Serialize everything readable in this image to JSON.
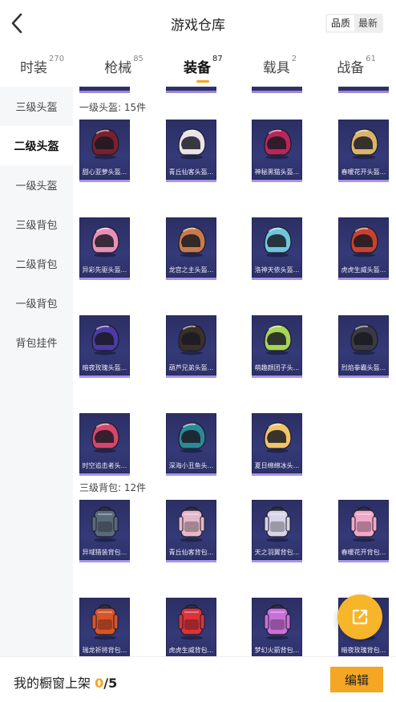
{
  "header": {
    "title": "游戏仓库",
    "sort_options": [
      "品质",
      "最新"
    ],
    "sort_active": "品质"
  },
  "category_tabs": [
    {
      "label": "时装",
      "count": "270",
      "active": false
    },
    {
      "label": "枪械",
      "count": "85",
      "active": false
    },
    {
      "label": "装备",
      "count": "87",
      "active": true
    },
    {
      "label": "载具",
      "count": "2",
      "active": false
    },
    {
      "label": "战备",
      "count": "61",
      "active": false
    }
  ],
  "sidebar": {
    "items": [
      {
        "label": "三级头盔",
        "active": false
      },
      {
        "label": "二级头盔",
        "active": true
      },
      {
        "label": "一级头盔",
        "active": false
      },
      {
        "label": "三级背包",
        "active": false
      },
      {
        "label": "二级背包",
        "active": false
      },
      {
        "label": "一级背包",
        "active": false
      },
      {
        "label": "背包挂件",
        "active": false
      }
    ]
  },
  "sections": [
    {
      "title": "一级头盔: 15件",
      "items": [
        {
          "name": "甜心亚萝头盔...",
          "color": "#7a1f2e",
          "type": "helmet"
        },
        {
          "name": "青丘仙客头盔...",
          "color": "#e8e4ea",
          "type": "helmet"
        },
        {
          "name": "神秘黑猫头盔...",
          "color": "#b8265a",
          "type": "helmet"
        },
        {
          "name": "春暖花开头盔...",
          "color": "#d9b46a",
          "type": "helmet"
        },
        {
          "name": "异彩先驱头盔...",
          "color": "#e88fb8",
          "type": "helmet"
        },
        {
          "name": "龙宫之主头盔...",
          "color": "#c97a4a",
          "type": "helmet"
        },
        {
          "name": "洛神天依头盔...",
          "color": "#6fc5dc",
          "type": "helmet"
        },
        {
          "name": "虎虎生威头盔...",
          "color": "#c8432e",
          "type": "helmet"
        },
        {
          "name": "暗夜玫瑰头盔...",
          "color": "#4b3aa8",
          "type": "helmet"
        },
        {
          "name": "葫芦兄弟头盔...",
          "color": "#3a3028",
          "type": "helmet"
        },
        {
          "name": "萌趣颜团子头...",
          "color": "#a8d45a",
          "type": "helmet"
        },
        {
          "name": "烈焰拳霸头盔...",
          "color": "#3a3a44",
          "type": "helmet"
        },
        {
          "name": "时空追击者头...",
          "color": "#d8456a",
          "type": "helmet"
        },
        {
          "name": "深海小丑鱼头...",
          "color": "#2a8a96",
          "type": "helmet"
        },
        {
          "name": "夏日绵绵冰头...",
          "color": "#f2c46a",
          "type": "helmet"
        }
      ]
    },
    {
      "title": "三级背包: 12件",
      "items": [
        {
          "name": "异域猎装背包...",
          "color": "#5a6a7a",
          "type": "backpack"
        },
        {
          "name": "青丘仙客背包...",
          "color": "#e4b8c8",
          "type": "backpack"
        },
        {
          "name": "天之羽翼背包...",
          "color": "#d8d4e8",
          "type": "backpack"
        },
        {
          "name": "春暖花开背包...",
          "color": "#f0a8c8",
          "type": "backpack"
        },
        {
          "name": "瑞龙祈将背包...",
          "color": "#d8542a",
          "type": "backpack"
        },
        {
          "name": "虎虎生威背包...",
          "color": "#d8343a",
          "type": "backpack"
        },
        {
          "name": "梦幻火箭背包...",
          "color": "#c870d8",
          "type": "backpack"
        },
        {
          "name": "暗夜玫瑰背包...",
          "color": "#d8342a",
          "type": "backpack"
        }
      ]
    }
  ],
  "bottom_bar": {
    "label": "我的橱窗上架",
    "current": "0",
    "total": "/5",
    "edit_label": "编辑"
  },
  "icons": {
    "back": "chevron-left-icon",
    "share": "share-external-icon"
  }
}
